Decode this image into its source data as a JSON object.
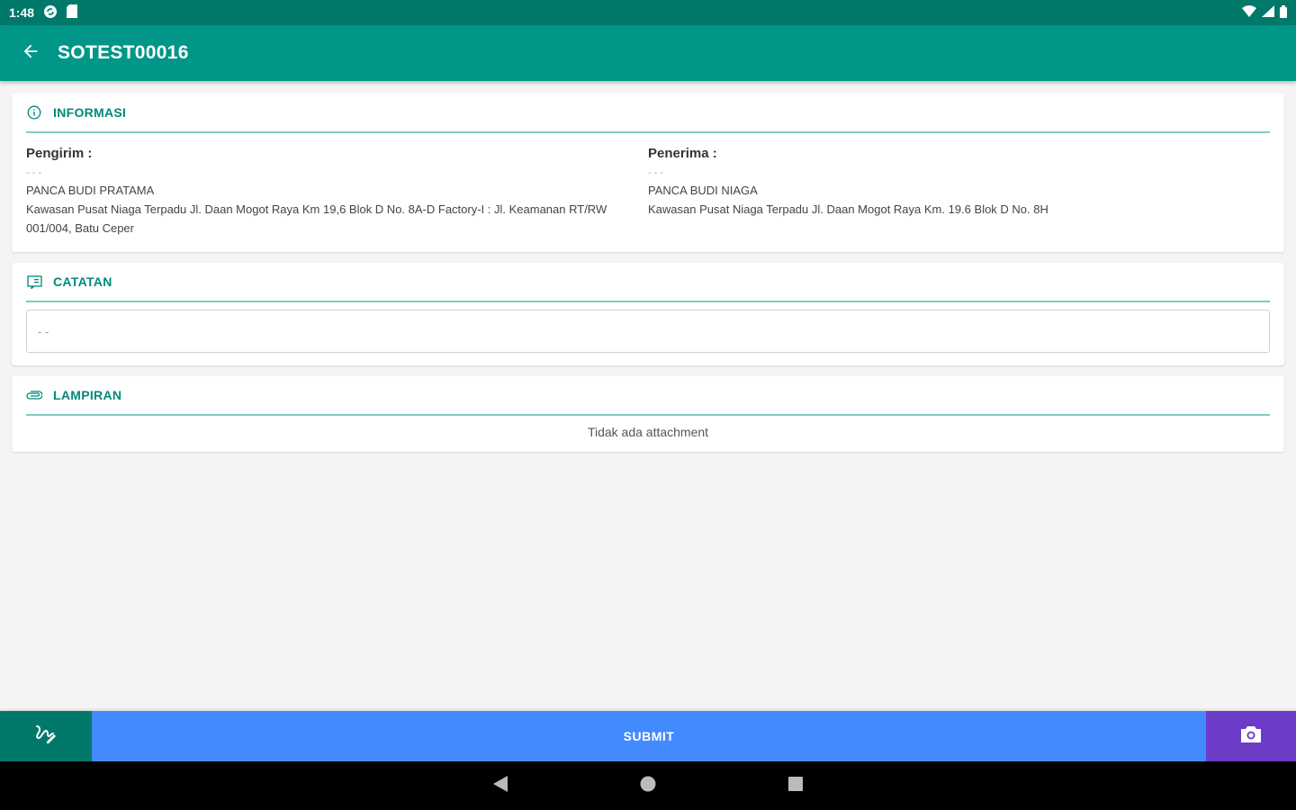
{
  "status_bar": {
    "time": "1:48",
    "icons": [
      "sync-icon",
      "sd-card-icon",
      "wifi-icon",
      "signal-icon",
      "battery-icon"
    ]
  },
  "app_bar": {
    "title": "SOTEST00016",
    "back_icon": "arrow-back-icon"
  },
  "info_card": {
    "header": "INFORMASI",
    "icon": "info-icon",
    "sender": {
      "label": "Pengirim :",
      "placeholder_dots": "- - -",
      "name": "PANCA BUDI PRATAMA",
      "address": "Kawasan Pusat Niaga Terpadu Jl. Daan Mogot Raya Km 19,6 Blok D No. 8A-D Factory-I : Jl. Keamanan RT/RW 001/004, Batu Ceper"
    },
    "receiver": {
      "label": "Penerima :",
      "placeholder_dots": "- - -",
      "name": "PANCA BUDI NIAGA",
      "address": "Kawasan Pusat Niaga Terpadu Jl. Daan Mogot Raya Km. 19.6 Blok D No. 8H"
    }
  },
  "notes_card": {
    "header": "CATATAN",
    "icon": "note-icon",
    "input_value": "- -"
  },
  "attachment_card": {
    "header": "LAMPIRAN",
    "icon": "attachment-icon",
    "empty_text": "Tidak ada attachment"
  },
  "bottom_bar": {
    "submit_label": "SUBMIT",
    "left_icon": "signature-icon",
    "right_icon": "camera-icon"
  },
  "colors": {
    "primary": "#009688",
    "primary_dark": "#00796b",
    "accent_blue": "#448aff",
    "accent_purple": "#6a3cc7"
  }
}
